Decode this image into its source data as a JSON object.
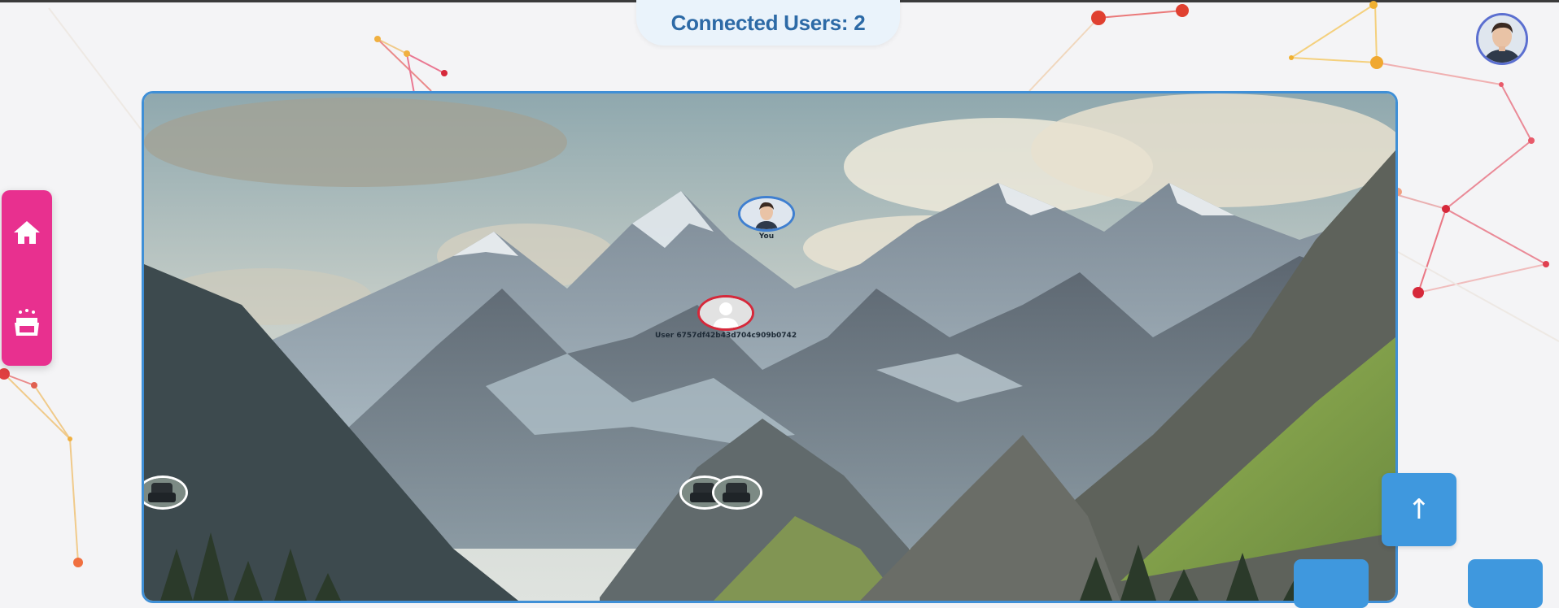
{
  "header": {
    "connected_users_label": "Connected Users: 2"
  },
  "profile": {
    "avatar_icon": "person-avatar"
  },
  "side_nav": {
    "items": [
      {
        "icon": "home-icon"
      },
      {
        "icon": "cinema-icon"
      }
    ]
  },
  "room": {
    "background": "mountain-landscape",
    "users": [
      {
        "label": "You",
        "border_color": "#3f7fd0"
      },
      {
        "label": "User 6757df42b43d704c909b0742",
        "border_color": "#d6283a"
      }
    ],
    "seats": [
      {
        "icon": "armchair-icon"
      },
      {
        "icon": "armchair-icon"
      },
      {
        "icon": "armchair-icon"
      }
    ]
  },
  "buttons": {
    "scroll_top_icon": "arrow-up-icon",
    "scroll_top_glyph": "↑"
  },
  "colors": {
    "accent_pink": "#e8308f",
    "accent_blue": "#3f98de",
    "frame_blue": "#3f8fd6",
    "title_blue": "#2d6aa6"
  }
}
